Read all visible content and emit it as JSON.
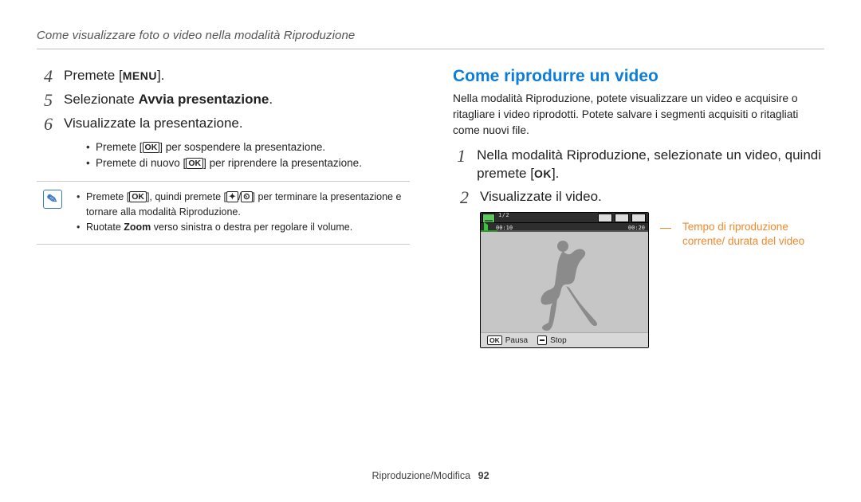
{
  "header": "Come visualizzare foto o video nella modalità Riproduzione",
  "left": {
    "step4": {
      "num": "4",
      "pre": "Premete [",
      "btn": "MENU",
      "post": "]."
    },
    "step5": {
      "num": "5",
      "pre": "Selezionate ",
      "bold": "Avvia presentazione",
      "post": "."
    },
    "step6": {
      "num": "6",
      "text": "Visualizzate la presentazione."
    },
    "sub1": {
      "pre": "Premete [",
      "btn": "OK",
      "post": "] per sospendere la presentazione."
    },
    "sub2": {
      "pre": "Premete di nuovo [",
      "btn": "OK",
      "post": "] per riprendere la presentazione."
    },
    "note1": {
      "pre": "Premete [",
      "btn": "OK",
      "mid": "], quindi premete [",
      "glyph1": "✦",
      "slash": "/",
      "glyph2": "⏲",
      "post": "] per terminare la presentazione e tornare alla modalità Riproduzione."
    },
    "note2": {
      "pre": "Ruotate ",
      "bold": "Zoom",
      "post": " verso sinistra o destra per regolare il volume."
    }
  },
  "right": {
    "title": "Come riprodurre un video",
    "intro": "Nella modalità Riproduzione, potete visualizzare un video e acquisire o ritagliare i video riprodotti. Potete salvare i segmenti acquisiti o ritagliati come nuovi file.",
    "step1": {
      "num": "1",
      "pre": "Nella modalità Riproduzione, selezionate un video, quindi premete [",
      "btn": "OK",
      "post": "]."
    },
    "step2": {
      "num": "2",
      "text": "Visualizzate il video."
    },
    "osd": {
      "count": "1/2",
      "time_left": "00:10",
      "time_right": "00:20"
    },
    "footer_btns": {
      "ok": "OK",
      "pausa": "Pausa",
      "stop": "Stop"
    },
    "callout": "Tempo di riproduzione corrente/ durata del video"
  },
  "footer": {
    "section": "Riproduzione/Modifica",
    "page": "92"
  }
}
